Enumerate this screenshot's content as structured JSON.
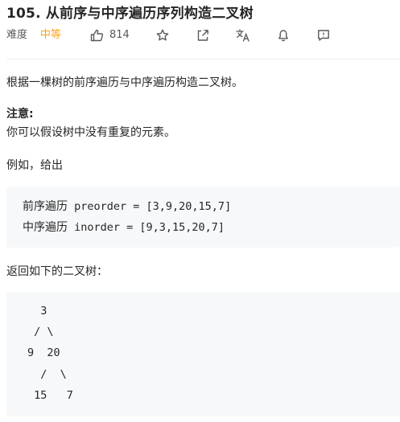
{
  "problem": {
    "title": "105. 从前序与中序遍历序列构造二叉树"
  },
  "meta": {
    "difficulty_label": "难度",
    "difficulty_value": "中等",
    "likes": "814",
    "icons": [
      "thumbs-up-icon",
      "star-icon",
      "share-icon",
      "translate-icon",
      "bell-icon",
      "feedback-icon"
    ],
    "accent_color": "#ffa116"
  },
  "content": {
    "description": "根据一棵树的前序遍历与中序遍历构造二叉树。",
    "note_title": "注意:",
    "note_body": "你可以假设树中没有重复的元素。",
    "example_label": "例如，给出",
    "example_lines": [
      {
        "label": "前序遍历",
        "code": " preorder = [3,9,20,15,7]"
      },
      {
        "label": "中序遍历",
        "code": " inorder = [9,3,15,20,7]"
      }
    ],
    "returns_label": "返回如下的二叉树：",
    "tree_lines": [
      "  3",
      " / \\",
      "9  20",
      "  /  \\",
      " 15   7"
    ]
  }
}
